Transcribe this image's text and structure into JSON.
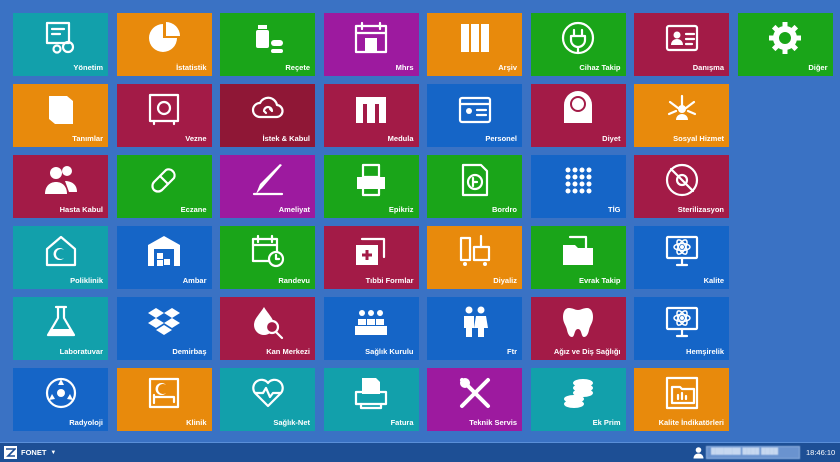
{
  "tiles": [
    {
      "label": "Yönetim",
      "color": "#12a0ab",
      "icon": "settings-document-icon"
    },
    {
      "label": "İstatistik",
      "color": "#e88a0c",
      "icon": "pie-chart-icon"
    },
    {
      "label": "Reçete",
      "color": "#1aa519",
      "icon": "medicine-icon"
    },
    {
      "label": "Mhrs",
      "color": "#9d1a9f",
      "icon": "calendar-hospital-icon"
    },
    {
      "label": "Arşiv",
      "color": "#e88a0c",
      "icon": "archive-binders-icon"
    },
    {
      "label": "Cihaz Takip",
      "color": "#1aa519",
      "icon": "plug-icon"
    },
    {
      "label": "Danışma",
      "color": "#a31b47",
      "icon": "contact-card-icon"
    },
    {
      "label": "Diğer",
      "color": "#1aa519",
      "icon": "gear-icon"
    },
    {
      "label": "Tanımlar",
      "color": "#e88a0c",
      "icon": "book-icon"
    },
    {
      "label": "Vezne",
      "color": "#a31b47",
      "icon": "safe-icon"
    },
    {
      "label": "İstek & Kabul",
      "color": "#8f1736",
      "icon": "cloud-sync-icon"
    },
    {
      "label": "Medula",
      "color": "#a31b47",
      "icon": "medula-logo-icon"
    },
    {
      "label": "Personel",
      "color": "#1565c7",
      "icon": "id-badge-icon"
    },
    {
      "label": "Diyet",
      "color": "#a31b47",
      "icon": "scale-icon"
    },
    {
      "label": "Sosyal Hizmet",
      "color": "#e88a0c",
      "icon": "network-person-icon"
    },
    {
      "label": "Hasta Kabul",
      "color": "#a31b47",
      "icon": "patients-icon"
    },
    {
      "label": "Eczane",
      "color": "#1aa519",
      "icon": "capsule-icon"
    },
    {
      "label": "Ameliyat",
      "color": "#9d1a9f",
      "icon": "scalpel-icon"
    },
    {
      "label": "Epikriz",
      "color": "#1aa519",
      "icon": "printer-report-icon"
    },
    {
      "label": "Bordro",
      "color": "#1aa519",
      "icon": "payroll-document-icon"
    },
    {
      "label": "TİG",
      "color": "#1565c7",
      "icon": "dot-grid-icon"
    },
    {
      "label": "Sterilizasyon",
      "color": "#a31b47",
      "icon": "no-germ-icon"
    },
    {
      "label": "Poliklinik",
      "color": "#12a0ab",
      "icon": "clinic-house-icon"
    },
    {
      "label": "Ambar",
      "color": "#1565c7",
      "icon": "warehouse-icon"
    },
    {
      "label": "Randevu",
      "color": "#1aa519",
      "icon": "calendar-clock-icon"
    },
    {
      "label": "Tıbbi Formlar",
      "color": "#a31b47",
      "icon": "medical-folders-icon"
    },
    {
      "label": "Diyaliz",
      "color": "#e88a0c",
      "icon": "dialysis-icon"
    },
    {
      "label": "Evrak Takip",
      "color": "#1aa519",
      "icon": "folder-documents-icon"
    },
    {
      "label": "Kalite",
      "color": "#1565c7",
      "icon": "monitor-atom-icon"
    },
    {
      "label": "Laboratuvar",
      "color": "#12a0ab",
      "icon": "flask-icon"
    },
    {
      "label": "Demirbaş",
      "color": "#1565c7",
      "icon": "dropbox-icon"
    },
    {
      "label": "Kan Merkezi",
      "color": "#a31b47",
      "icon": "blood-drop-search-icon"
    },
    {
      "label": "Sağlık Kurulu",
      "color": "#1565c7",
      "icon": "committee-icon"
    },
    {
      "label": "Ftr",
      "color": "#1565c7",
      "icon": "elderly-couple-icon"
    },
    {
      "label": "Ağız ve Diş Sağlığı",
      "color": "#a31b47",
      "icon": "tooth-icon"
    },
    {
      "label": "Hemşirelik",
      "color": "#1565c7",
      "icon": "monitor-atom-icon"
    },
    {
      "label": "Radyoloji",
      "color": "#1565c7",
      "icon": "radiation-icon"
    },
    {
      "label": "Klinik",
      "color": "#e88a0c",
      "icon": "hospital-bed-icon"
    },
    {
      "label": "Sağlık-Net",
      "color": "#12a0ab",
      "icon": "heart-pulse-icon"
    },
    {
      "label": "Fatura",
      "color": "#12a0ab",
      "icon": "invoice-printer-icon"
    },
    {
      "label": "Teknik Servis",
      "color": "#9d1a9f",
      "icon": "wrench-screwdriver-icon"
    },
    {
      "label": "Ek Prim",
      "color": "#12a0ab",
      "icon": "coins-icon"
    },
    {
      "label": "Kalite İndikatörleri",
      "color": "#e88a0c",
      "icon": "folder-chart-icon"
    }
  ],
  "taskbar": {
    "start_label": "FONET",
    "user_text": "███████ ████ ████",
    "clock": "18:46:10"
  }
}
